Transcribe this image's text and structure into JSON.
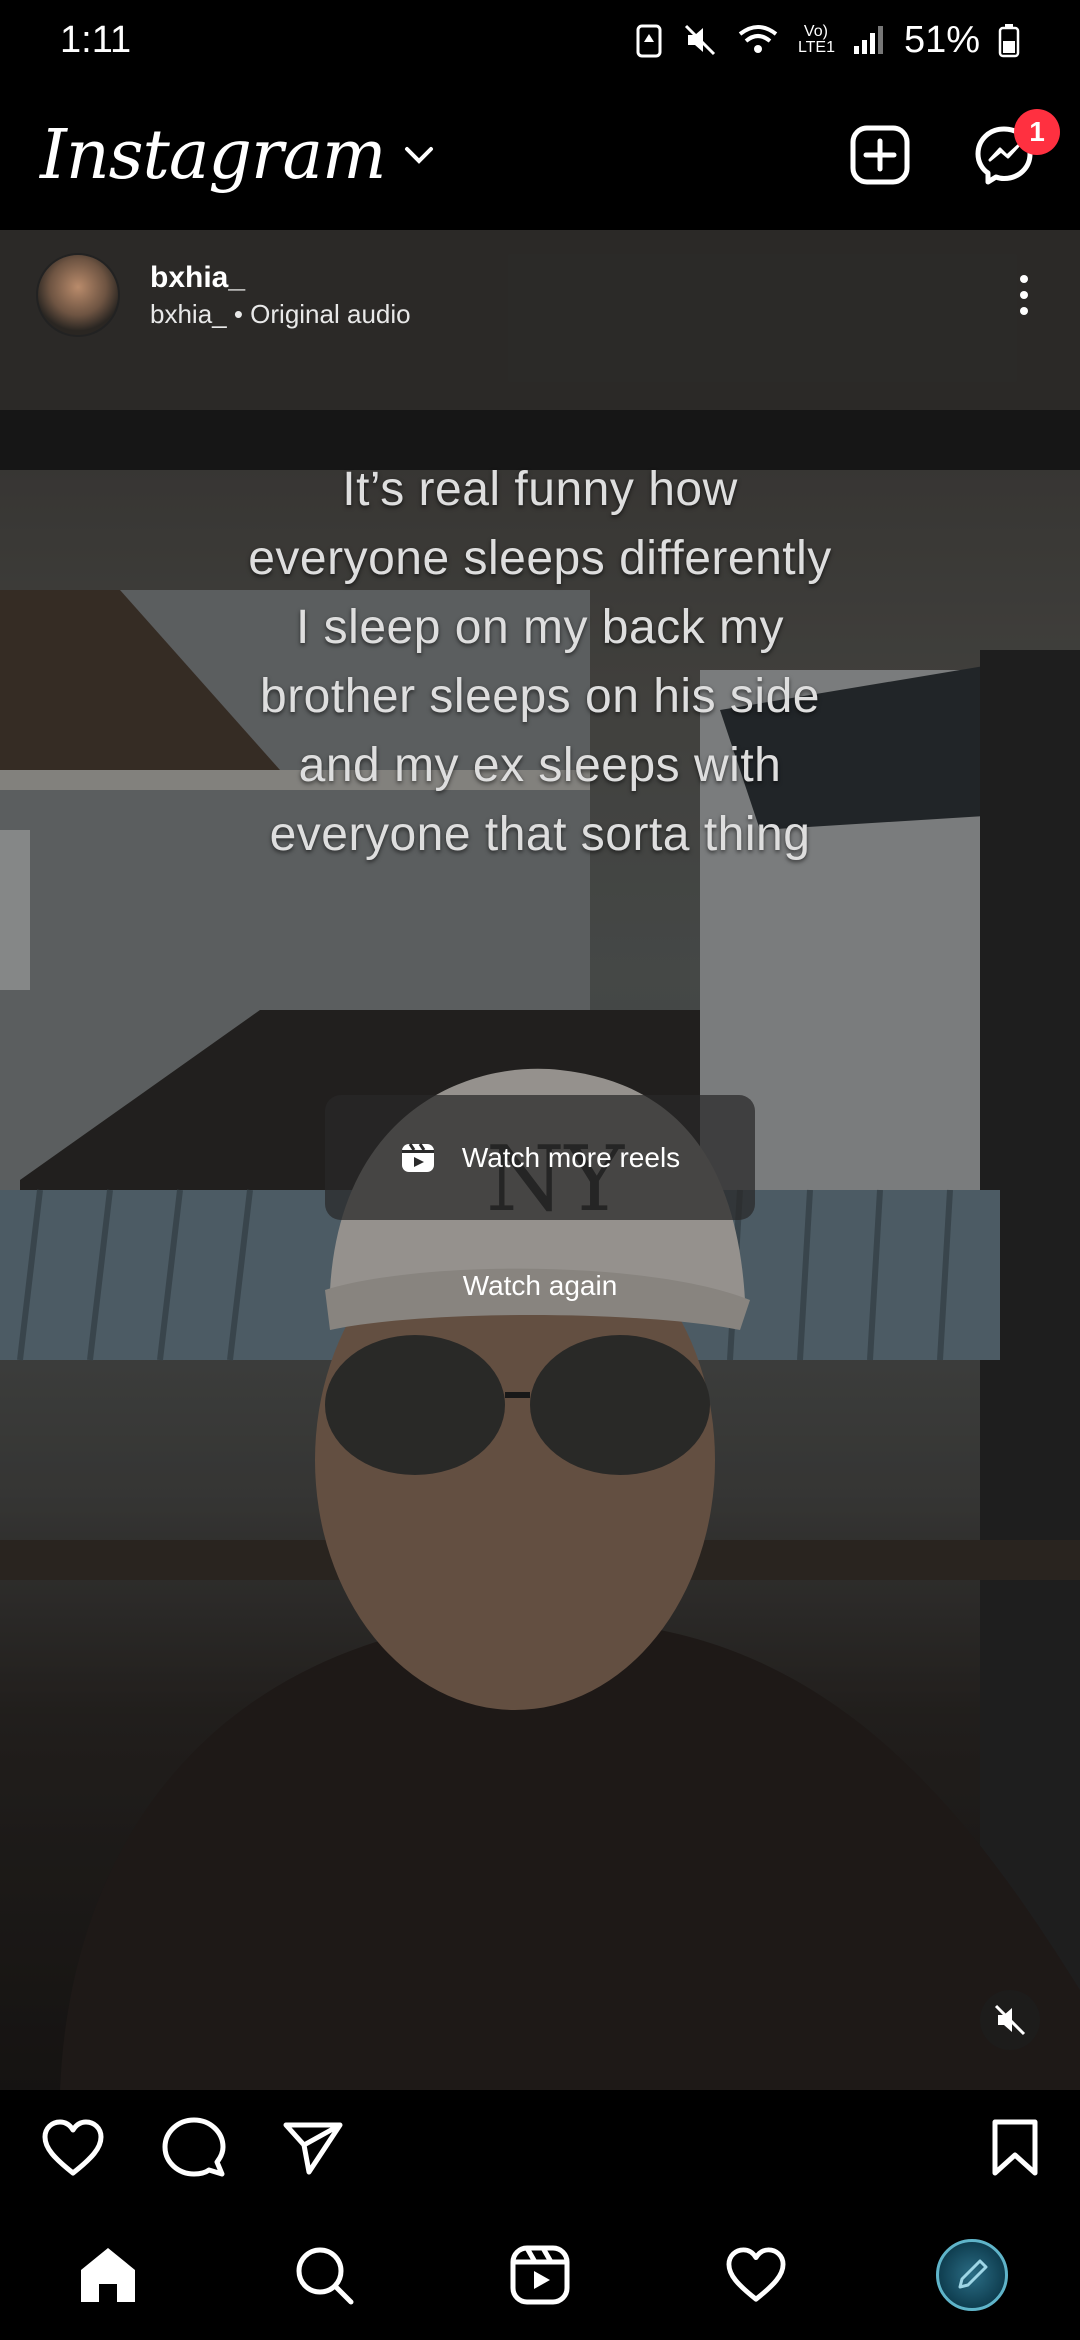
{
  "status_bar": {
    "time": "1:11",
    "network": "Vo) LTE1",
    "battery": "51%"
  },
  "header": {
    "brand": "Instagram",
    "notification_count": "1"
  },
  "post": {
    "username": "bxhia_",
    "audio": "bxhia_ • Original audio",
    "overlay_lines": [
      "It’s real funny how",
      "everyone sleeps differently",
      "I sleep on my back my",
      "brother sleeps on his side",
      "and my ex sleeps with",
      "everyone that sorta thing"
    ],
    "watch_more_label": "Watch more reels",
    "watch_again_label": "Watch again"
  },
  "icons": {
    "header": [
      "chevron-down-icon",
      "create-post-icon",
      "messenger-icon"
    ],
    "actions": [
      "heart-icon",
      "comment-icon",
      "share-icon",
      "bookmark-icon"
    ],
    "nav": [
      "home-icon",
      "search-icon",
      "reels-icon",
      "activity-heart-icon",
      "profile-avatar"
    ]
  }
}
